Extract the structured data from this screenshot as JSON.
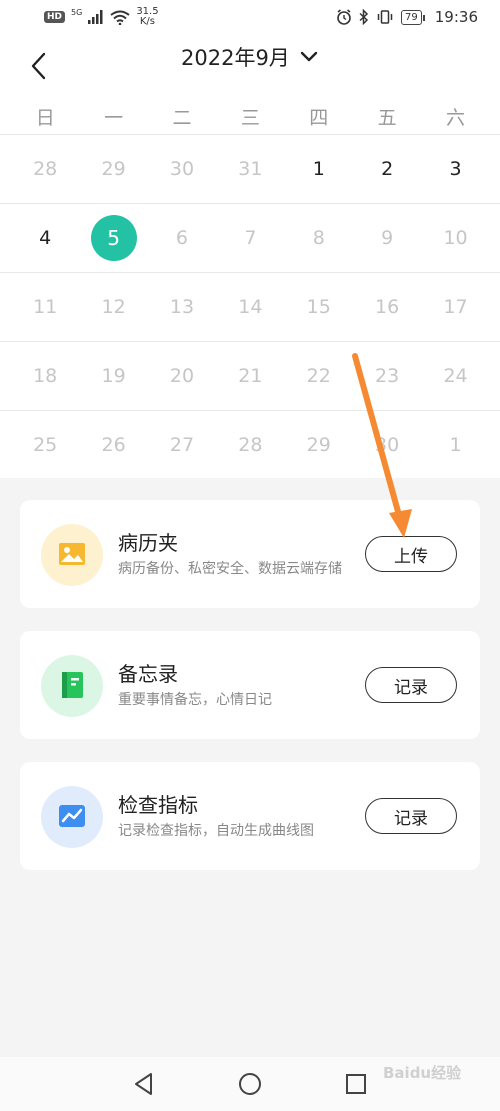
{
  "status_bar": {
    "hd": "HD",
    "signal_5g": "5G",
    "net_speed_value": "31.5",
    "net_speed_unit": "K/s",
    "battery": "79",
    "time": "19:36"
  },
  "calendar": {
    "month_title": "2022年9月",
    "weekdays": [
      "日",
      "一",
      "二",
      "三",
      "四",
      "五",
      "六"
    ],
    "weeks": [
      [
        {
          "d": "28",
          "cur": false
        },
        {
          "d": "29",
          "cur": false
        },
        {
          "d": "30",
          "cur": false
        },
        {
          "d": "31",
          "cur": false
        },
        {
          "d": "1",
          "cur": true
        },
        {
          "d": "2",
          "cur": true
        },
        {
          "d": "3",
          "cur": true
        }
      ],
      [
        {
          "d": "4",
          "cur": true
        },
        {
          "d": "5",
          "cur": true,
          "sel": true
        },
        {
          "d": "6",
          "cur": false
        },
        {
          "d": "7",
          "cur": false
        },
        {
          "d": "8",
          "cur": false
        },
        {
          "d": "9",
          "cur": false
        },
        {
          "d": "10",
          "cur": false
        }
      ],
      [
        {
          "d": "11",
          "cur": false
        },
        {
          "d": "12",
          "cur": false
        },
        {
          "d": "13",
          "cur": false
        },
        {
          "d": "14",
          "cur": false
        },
        {
          "d": "15",
          "cur": false
        },
        {
          "d": "16",
          "cur": false
        },
        {
          "d": "17",
          "cur": false
        }
      ],
      [
        {
          "d": "18",
          "cur": false
        },
        {
          "d": "19",
          "cur": false
        },
        {
          "d": "20",
          "cur": false
        },
        {
          "d": "21",
          "cur": false
        },
        {
          "d": "22",
          "cur": false
        },
        {
          "d": "23",
          "cur": false
        },
        {
          "d": "24",
          "cur": false
        }
      ],
      [
        {
          "d": "25",
          "cur": false
        },
        {
          "d": "26",
          "cur": false
        },
        {
          "d": "27",
          "cur": false
        },
        {
          "d": "28",
          "cur": false
        },
        {
          "d": "29",
          "cur": false
        },
        {
          "d": "30",
          "cur": false
        },
        {
          "d": "1",
          "cur": false
        }
      ]
    ],
    "selected_color": "#24c2a4"
  },
  "cards": [
    {
      "title": "病历夹",
      "desc": "病历备份、私密安全、数据云端存储",
      "button": "上传",
      "icon": "image-icon",
      "icon_bg": "#fdf1cf",
      "icon_color": "#f5b82e"
    },
    {
      "title": "备忘录",
      "desc": "重要事情备忘，心情日记",
      "button": "记录",
      "icon": "notebook-icon",
      "icon_bg": "#dcf6e6",
      "icon_color": "#27c45c"
    },
    {
      "title": "检查指标",
      "desc": "记录检查指标，自动生成曲线图",
      "button": "记录",
      "icon": "chart-icon",
      "icon_bg": "#e0ecfc",
      "icon_color": "#3d8ef0"
    }
  ],
  "annotation": {
    "arrow_color": "#f58a32"
  },
  "watermark": "Baidu经验"
}
